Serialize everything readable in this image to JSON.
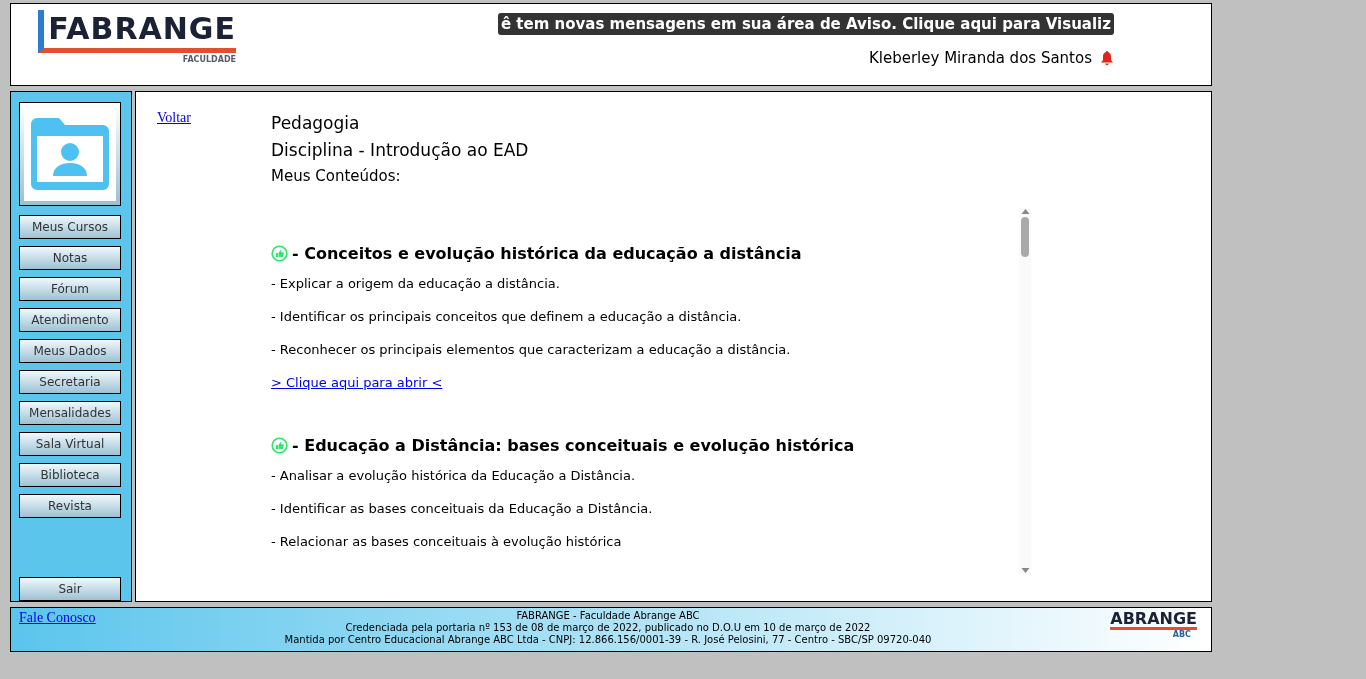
{
  "header": {
    "logo": {
      "name": "FABRANGE",
      "tagline": "FACULDADE"
    },
    "notice": "ê tem novas mensagens em sua área de Aviso. Clique aqui para Visualiz",
    "user_name": "Kleberley Miranda dos Santos"
  },
  "sidebar": {
    "items": [
      "Meus Cursos",
      "Notas",
      "Fórum",
      "Atendimento",
      "Meus Dados",
      "Secretaria",
      "Mensalidades",
      "Sala Virtual",
      "Biblioteca",
      "Revista"
    ],
    "logout": "Sair"
  },
  "main": {
    "back_link": "Voltar",
    "course": "Pedagogia",
    "discipline": "Disciplina - Introdução ao EAD",
    "section_title": "Meus Conteúdos:",
    "contents": [
      {
        "title": "- Conceitos e evolução histórica da educação a distância",
        "objectives": [
          "- Explicar a origem da educação a distância.",
          "- Identificar os principais conceitos que definem a educação a distância.",
          "- Reconhecer os principais elementos que caracterizam a educação a distância."
        ],
        "link": "> Clique aqui para abrir <"
      },
      {
        "title": "- Educação a Distância: bases conceituais e evolução histórica",
        "objectives": [
          "- Analisar a evolução histórica da Educação a Distância.",
          "- Identificar as bases conceituais da Educação a Distância.",
          "- Relacionar as bases conceituais à evolução histórica"
        ]
      }
    ]
  },
  "footer": {
    "contact_link": "Fale Conosco",
    "lines": [
      "FABRANGE - Faculdade Abrange ABC",
      "Credenciada pela portaria nº 153 de 08 de março de 2022, publicado no D.O.U em 10 de março de 2022",
      "Mantida por Centro Educacional Abrange ABC Ltda - CNPJ: 12.866.156/0001-39 - R. José Pelosini, 77 - Centro - SBC/SP 09720-040"
    ],
    "logo": {
      "name": "ABRANGE",
      "tagline": "ABC"
    }
  }
}
